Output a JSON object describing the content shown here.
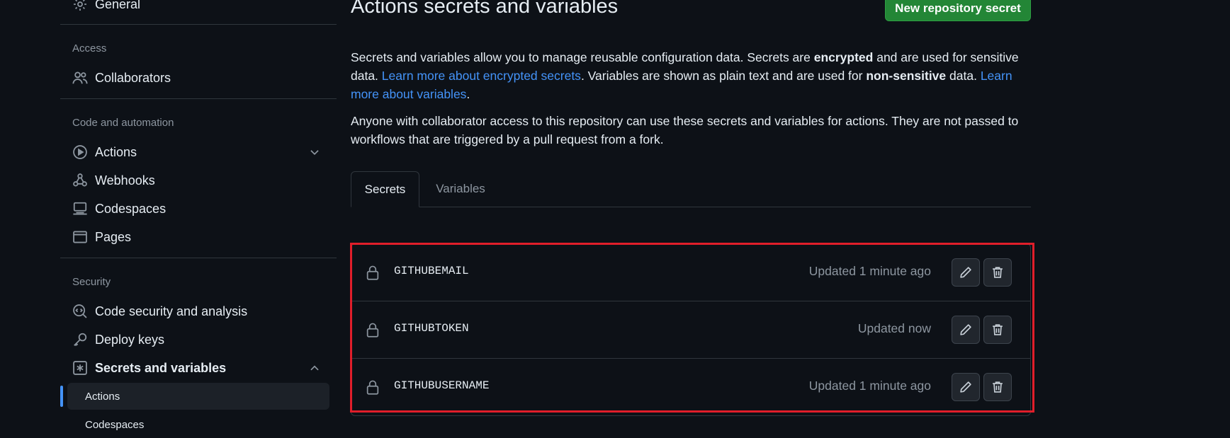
{
  "sidebar": {
    "general_label": "General",
    "access_header": "Access",
    "collaborators_label": "Collaborators",
    "code_automation_header": "Code and automation",
    "actions_label": "Actions",
    "webhooks_label": "Webhooks",
    "codespaces_label": "Codespaces",
    "pages_label": "Pages",
    "security_header": "Security",
    "code_security_label": "Code security and analysis",
    "deploy_keys_label": "Deploy keys",
    "secrets_variables_label": "Secrets and variables",
    "sub_actions_label": "Actions",
    "sub_codespaces_label": "Codespaces"
  },
  "main": {
    "title": "Actions secrets and variables",
    "new_secret_button": "New repository secret",
    "intro": {
      "p1": "Secrets and variables allow you to manage reusable configuration data. Secrets are ",
      "p1_bold": "encrypted",
      "p2": " and are used for sensitive data. ",
      "link1": "Learn more about encrypted secrets",
      "p3": ". Variables are shown as plain text and are used for ",
      "p3_bold": "non-sensitive",
      "p4": " data. ",
      "link2": "Learn more about variables",
      "p5": "."
    },
    "notice": "Anyone with collaborator access to this repository can use these secrets and variables for actions. They are not passed to workflows that are triggered by a pull request from a fork.",
    "tabs": [
      "Secrets",
      "Variables"
    ],
    "secrets": [
      {
        "name": "GITHUBEMAIL",
        "updated": "Updated 1 minute ago"
      },
      {
        "name": "GITHUBTOKEN",
        "updated": "Updated now"
      },
      {
        "name": "GITHUBUSERNAME",
        "updated": "Updated 1 minute ago"
      }
    ]
  },
  "colors": {
    "background": "#0d1117",
    "accent": "#4493f8",
    "primary_button": "#238636",
    "highlight_border": "#e01e2a"
  }
}
